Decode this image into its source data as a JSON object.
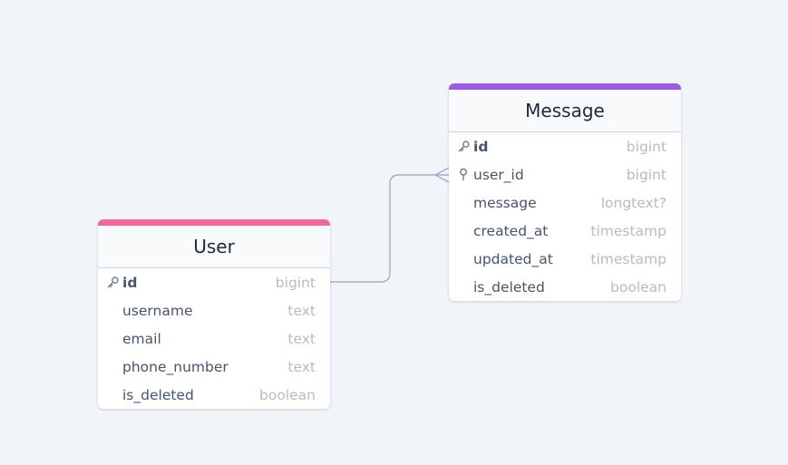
{
  "colors": {
    "background": "#f1f5f9",
    "user_accent": "#f06896",
    "message_accent": "#9c5be0",
    "connector": "#94a3b8"
  },
  "relationship": {
    "from": "User.id",
    "to": "Message.user_id",
    "cardinality": "one-to-many"
  },
  "tables": {
    "user": {
      "name": "User",
      "columns": [
        {
          "name": "id",
          "type": "bigint",
          "key": "primary-key-icon"
        },
        {
          "name": "username",
          "type": "text",
          "key": ""
        },
        {
          "name": "email",
          "type": "text",
          "key": ""
        },
        {
          "name": "phone_number",
          "type": "text",
          "key": ""
        },
        {
          "name": "is_deleted",
          "type": "boolean",
          "key": ""
        }
      ]
    },
    "message": {
      "name": "Message",
      "columns": [
        {
          "name": "id",
          "type": "bigint",
          "key": "primary-key-icon"
        },
        {
          "name": "user_id",
          "type": "bigint",
          "key": "foreign-key-icon"
        },
        {
          "name": "message",
          "type": "longtext?",
          "key": ""
        },
        {
          "name": "created_at",
          "type": "timestamp",
          "key": ""
        },
        {
          "name": "updated_at",
          "type": "timestamp",
          "key": ""
        },
        {
          "name": "is_deleted",
          "type": "boolean",
          "key": ""
        }
      ]
    }
  }
}
